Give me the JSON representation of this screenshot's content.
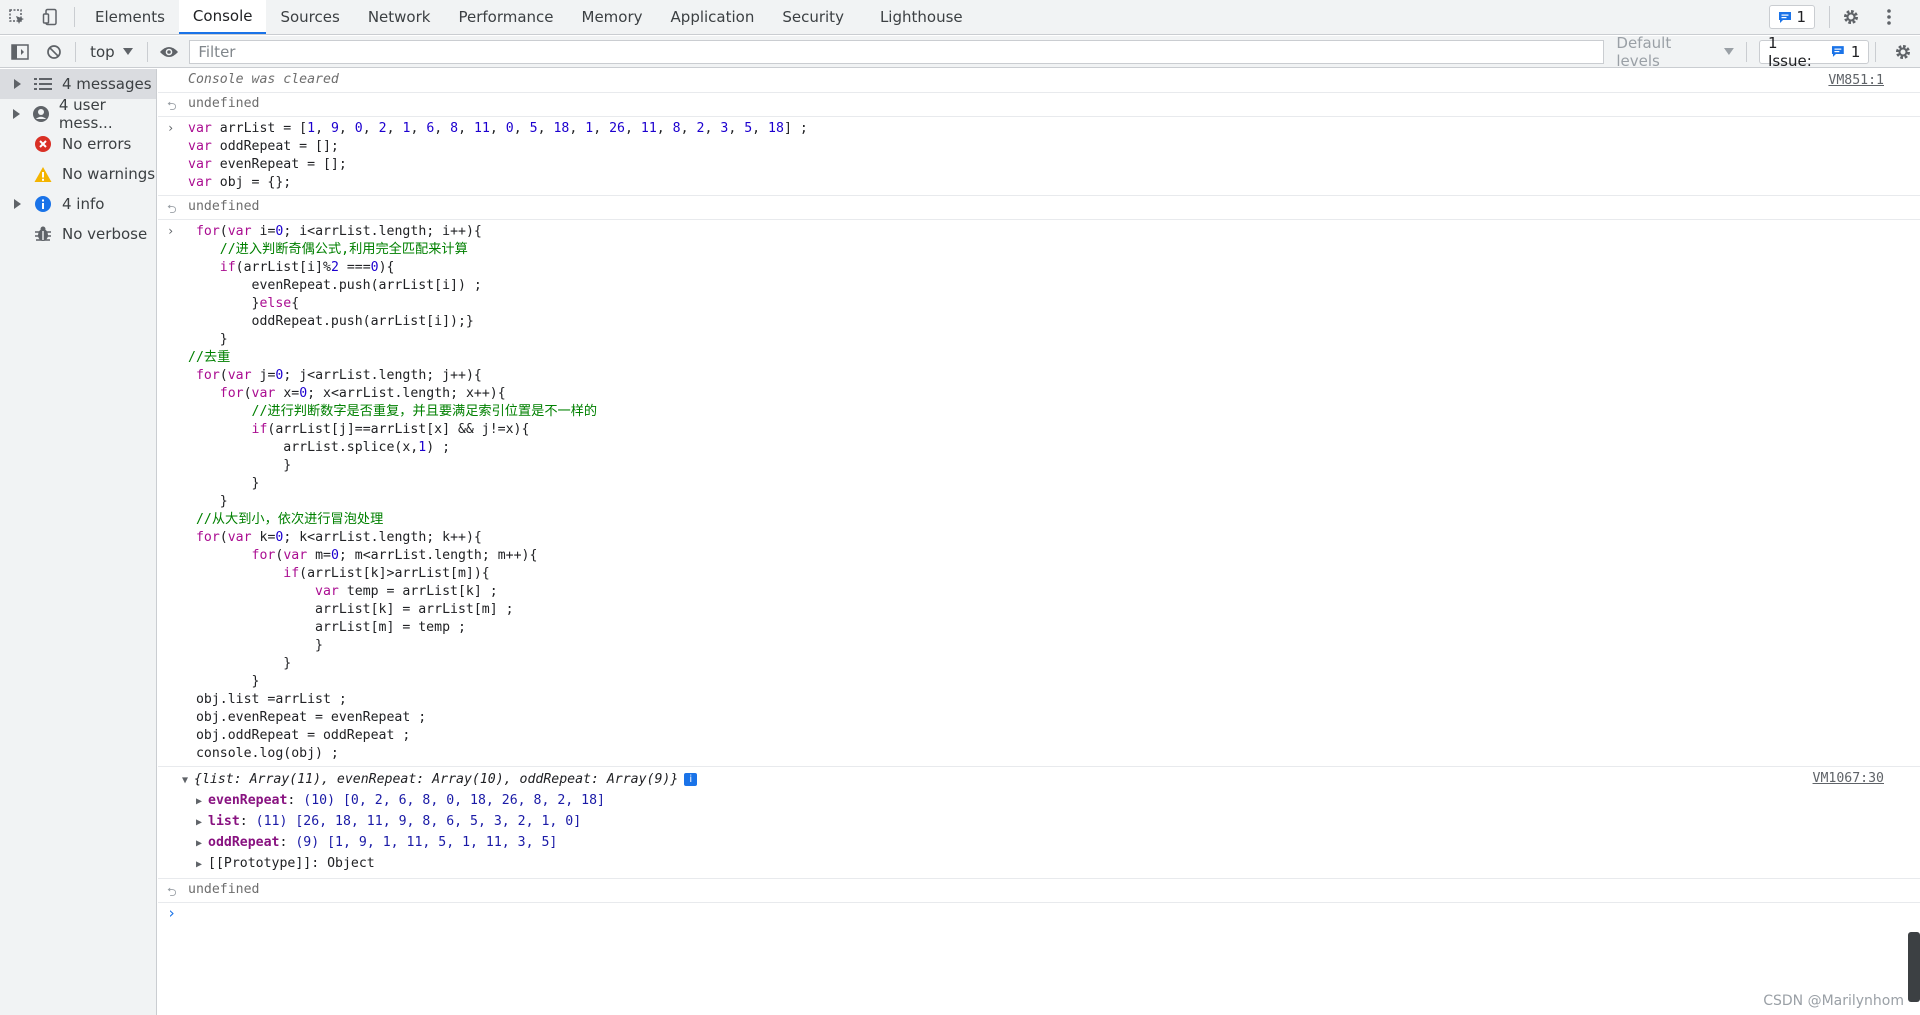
{
  "tabbar": {
    "tabs": [
      "Elements",
      "Console",
      "Sources",
      "Network",
      "Performance",
      "Memory",
      "Application",
      "Security",
      "Lighthouse"
    ],
    "active_tab": "Console",
    "messages_count": "1"
  },
  "toolbar": {
    "context": "top",
    "filter_placeholder": "Filter",
    "levels": "Default levels",
    "issues": "1 Issue:",
    "issues_count": "1"
  },
  "sidebar": {
    "items": [
      {
        "label": "4 messages",
        "icon": "list-icon",
        "expandable": true,
        "selected": true
      },
      {
        "label": "4 user mess...",
        "icon": "user-icon",
        "expandable": true
      },
      {
        "label": "No errors",
        "icon": "error-icon",
        "expandable": false
      },
      {
        "label": "No warnings",
        "icon": "warning-icon",
        "expandable": false
      },
      {
        "label": "4 info",
        "icon": "info-icon",
        "expandable": true
      },
      {
        "label": "No verbose",
        "icon": "verbose-icon",
        "expandable": false
      }
    ]
  },
  "console": {
    "cleared": "Console was cleared",
    "cleared_src": "VM851:1",
    "undefined": "undefined",
    "input1_lines": [
      "var arrList = [1, 9, 0, 2, 1, 6, 8, 11, 0, 5, 18, 1, 26, 11, 8, 2, 3, 5, 18] ;",
      "var oddRepeat = [];",
      "var evenRepeat = [];",
      "var obj = {};"
    ],
    "input2_lines": [
      " for(var i=0; i<arrList.length; i++){",
      "    //进入判断奇偶公式,利用完全匹配来计算",
      "    if(arrList[i]%2 ===0){",
      "        evenRepeat.push(arrList[i]) ;",
      "        }else{",
      "        oddRepeat.push(arrList[i]);}",
      "    }",
      "//去重",
      " for(var j=0; j<arrList.length; j++){",
      "    for(var x=0; x<arrList.length; x++){",
      "        //进行判断数字是否重复，并且要满足索引位置是不一样的",
      "        if(arrList[j]==arrList[x] && j!=x){",
      "            arrList.splice(x,1) ;",
      "            }",
      "        }",
      "    }",
      " //从大到小，依次进行冒泡处理",
      " for(var k=0; k<arrList.length; k++){",
      "        for(var m=0; m<arrList.length; m++){",
      "            if(arrList[k]>arrList[m]){",
      "                var temp = arrList[k] ;",
      "                arrList[k] = arrList[m] ;",
      "                arrList[m] = temp ;",
      "                }",
      "            }",
      "        }",
      " obj.list =arrList ;",
      " obj.evenRepeat = evenRepeat ;",
      " obj.oddRepeat = oddRepeat ;",
      " console.log(obj) ;"
    ],
    "obj_summary": "{list: Array(11), evenRepeat: Array(10), oddRepeat: Array(9)}",
    "obj_src": "VM1067:30",
    "props": [
      {
        "key": "evenRepeat",
        "value": "(10) [0, 2, 6, 8, 0, 18, 26, 8, 2, 18]"
      },
      {
        "key": "list",
        "value": "(11) [26, 18, 11, 9, 8, 6, 5, 3, 2, 1, 0]"
      },
      {
        "key": "oddRepeat",
        "value": "(9) [1, 9, 1, 11, 5, 1, 11, 3, 5]"
      }
    ],
    "prototype": "[[Prototype]]: Object"
  },
  "watermark": "CSDN @Marilynhom",
  "colors": {
    "accent": "#1a73e8",
    "keyword": "#aa0d91",
    "number": "#1c00cf",
    "comment": "#008000"
  }
}
